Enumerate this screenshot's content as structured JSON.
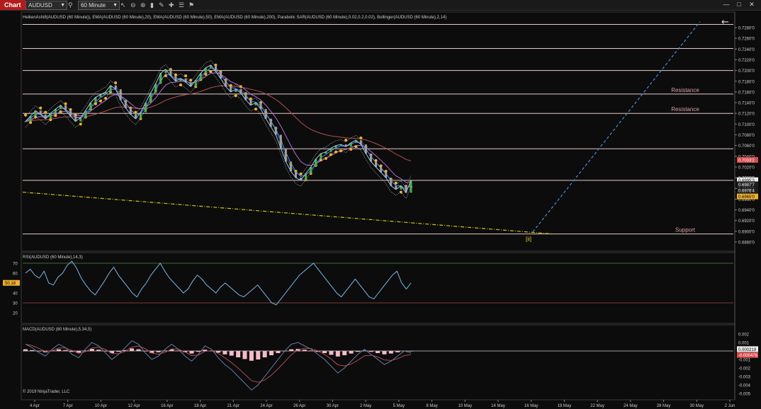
{
  "toolbar": {
    "chart_label": "Chart",
    "symbol": "AUDUSD",
    "interval": "60 Minute",
    "search_icon": "search-icon",
    "crosshair_icon": "crosshair-icon",
    "pointer_icon": "pointer-icon",
    "draw_icon": "draw-icon",
    "properties_icon": "properties-icon",
    "pin_icon": "pin-icon"
  },
  "window_controls": {
    "minimize": "—",
    "maximize": "□",
    "close": "✕"
  },
  "colors": {
    "background": "#0c0c0c",
    "hline": "#e8c8c8",
    "price_line": "#9ec4e6",
    "bollinger": "#d8d8d8",
    "ema20": "#4c8cff",
    "ema50": "#b06fd0",
    "ema200": "#b05050",
    "sar": "#f0b030",
    "trendline": "#d6c21a",
    "projection": "#4c8cd8",
    "macd_hist": "#f4bcc6",
    "rsi_line": "#7ab8e8"
  },
  "chart_data": [
    {
      "type": "line",
      "panel": "price",
      "indicator_header": "HeikenAshi8(AUDUSD (60 Minute)), EMA(AUDUSD (60 Minute),20), EMA(AUDUSD (60 Minute),50), EMA(AUDUSD (60 Minute),200), Parabolic SAR(AUDUSD (60 Minute),0.02,0.2,0.02), Bollinger(AUDUSD (60 Minute),2,14)",
      "ylim": [
        0.686,
        0.73
      ],
      "y_ticks": [
        "0.7280'0",
        "0.7260'0",
        "0.7240'0",
        "0.7220'0",
        "0.7200'0",
        "0.7180'0",
        "0.7160'0",
        "0.7140'0",
        "0.7120'0",
        "0.7100'0",
        "0.7080'0",
        "0.7060'0",
        "0.7040'0",
        "0.7020'0",
        "0.7000'0",
        "0.6980'0",
        "0.6960'0",
        "0.6940'0",
        "0.6920'0",
        "0.6900'0",
        "0.6880'0"
      ],
      "y_tick_values": [
        0.728,
        0.726,
        0.724,
        0.722,
        0.72,
        0.718,
        0.716,
        0.714,
        0.712,
        0.71,
        0.708,
        0.706,
        0.704,
        0.702,
        0.7,
        0.698,
        0.696,
        0.694,
        0.692,
        0.69,
        0.688
      ],
      "x_ticks": [
        "4 Apr",
        "7 Apr",
        "10 Apr",
        "12 Apr",
        "16 Apr",
        "18 Apr",
        "21 Apr",
        "24 Apr",
        "26 Apr",
        "30 Apr",
        "2 May",
        "5 May",
        "8 May",
        "10 May",
        "14 May",
        "16 May",
        "19 May",
        "22 May",
        "24 May",
        "28 May",
        "30 May",
        "2 Jun"
      ],
      "horizontal_levels": [
        0.7286,
        0.7241,
        0.72,
        0.7156,
        0.712,
        0.7054,
        0.6995,
        0.6895
      ],
      "level_labels": [
        {
          "text": "Resistance",
          "value": 0.7156
        },
        {
          "text": "Resistance",
          "value": 0.712
        },
        {
          "text": "Support",
          "value": 0.6895
        }
      ],
      "wave_label": "[ii]",
      "price_badges": [
        {
          "text": "0.7033'2",
          "value": 0.70332,
          "color": "#d84a4a"
        },
        {
          "text": "0.6995'3",
          "value": 0.69953,
          "color": "#f0f0f0"
        },
        {
          "text": "0.6987'7",
          "value": 0.69877,
          "color": "#1f1f1f"
        },
        {
          "text": "0.6976'4",
          "value": 0.69764,
          "color": "#1f1f1f"
        },
        {
          "text": "0.6965'0",
          "value": 0.6965,
          "color": "#f0b030"
        }
      ],
      "close": [
        0.7105,
        0.7115,
        0.7125,
        0.7118,
        0.711,
        0.712,
        0.7128,
        0.7135,
        0.7126,
        0.7115,
        0.7105,
        0.7112,
        0.7125,
        0.714,
        0.715,
        0.7155,
        0.716,
        0.7172,
        0.7165,
        0.7145,
        0.713,
        0.7118,
        0.711,
        0.7122,
        0.714,
        0.7158,
        0.7175,
        0.7195,
        0.7202,
        0.719,
        0.718,
        0.7185,
        0.7178,
        0.717,
        0.7182,
        0.7195,
        0.7205,
        0.721,
        0.7198,
        0.7185,
        0.717,
        0.716,
        0.7165,
        0.7158,
        0.7145,
        0.7135,
        0.714,
        0.7128,
        0.711,
        0.7095,
        0.708,
        0.7055,
        0.703,
        0.7012,
        0.7,
        0.6995,
        0.7008,
        0.702,
        0.7035,
        0.7045,
        0.7048,
        0.7055,
        0.706,
        0.7062,
        0.7058,
        0.7065,
        0.707,
        0.7062,
        0.7045,
        0.703,
        0.702,
        0.701,
        0.7,
        0.6985,
        0.6978,
        0.6985,
        0.6972,
        0.6995
      ]
    },
    {
      "type": "line",
      "panel": "rsi",
      "indicator_header": "RSI(AUDUSD (60 Minute),14,3)",
      "ylim": [
        0,
        80
      ],
      "y_ticks": [
        "70",
        "60",
        "50",
        "40",
        "30",
        "20"
      ],
      "y_tick_values": [
        70,
        60,
        50,
        40,
        30,
        20
      ],
      "overbought": 70,
      "oversold": 30,
      "current_badge": "50.18",
      "values": [
        60,
        64,
        58,
        55,
        62,
        50,
        48,
        56,
        60,
        68,
        72,
        65,
        55,
        48,
        42,
        38,
        45,
        52,
        60,
        66,
        58,
        52,
        46,
        40,
        36,
        44,
        50,
        58,
        64,
        70,
        62,
        55,
        50,
        45,
        40,
        44,
        52,
        58,
        54,
        48,
        44,
        40,
        46,
        50,
        46,
        42,
        38,
        36,
        40,
        44,
        48,
        42,
        36,
        30,
        28,
        34,
        40,
        46,
        52,
        58,
        62,
        66,
        70,
        64,
        58,
        52,
        46,
        40,
        36,
        42,
        48,
        54,
        48,
        42,
        36,
        34,
        40,
        46,
        52,
        58,
        62,
        50,
        44,
        50
      ]
    },
    {
      "type": "line",
      "panel": "macd",
      "indicator_header": "MACD(AUDUSD (60 Minute),5,34,5)",
      "ylim": [
        -0.0055,
        0.0025
      ],
      "y_ticks": [
        "0.002",
        "0.001",
        "0",
        "-0.001",
        "-0.002",
        "-0.003",
        "-0.004",
        "-0.005"
      ],
      "y_tick_values": [
        0.002,
        0.001,
        0,
        -0.001,
        -0.002,
        -0.003,
        -0.004,
        -0.005
      ],
      "badges": [
        {
          "text": "0.000219",
          "value": 0.000219,
          "color": "#f0f0f0"
        },
        {
          "text": "-0.000476",
          "value": -0.000476,
          "color": "#d84a4a"
        }
      ],
      "values": [
        0.0008,
        0.0004,
        -0.0002,
        -0.0006,
        0.0002,
        0.0008,
        0.0004,
        -0.0004,
        -0.0008,
        0.0002,
        0.001,
        0.0006,
        -0.0002,
        -0.001,
        -0.0004,
        0.0004,
        0.0012,
        0.0008,
        -0.0002,
        -0.001,
        -0.0006,
        0.0002,
        0.0008,
        0.0002,
        -0.0006,
        -0.0012,
        -0.0004,
        0.0006,
        0.0002,
        -0.0008,
        -0.0016,
        -0.0022,
        -0.003,
        -0.0038,
        -0.0046,
        -0.004,
        -0.003,
        -0.002,
        -0.001,
        0.0,
        0.0008,
        0.001,
        0.0006,
        0.0002,
        -0.0004,
        -0.001,
        -0.0018,
        -0.0026,
        -0.002,
        -0.0012,
        -0.0004,
        0.0002,
        -0.0004,
        -0.001,
        -0.0016,
        -0.0012,
        -0.0006,
        0.0,
        -0.0002
      ],
      "copyright": "© 2019 NinjaTrader, LLC"
    }
  ]
}
